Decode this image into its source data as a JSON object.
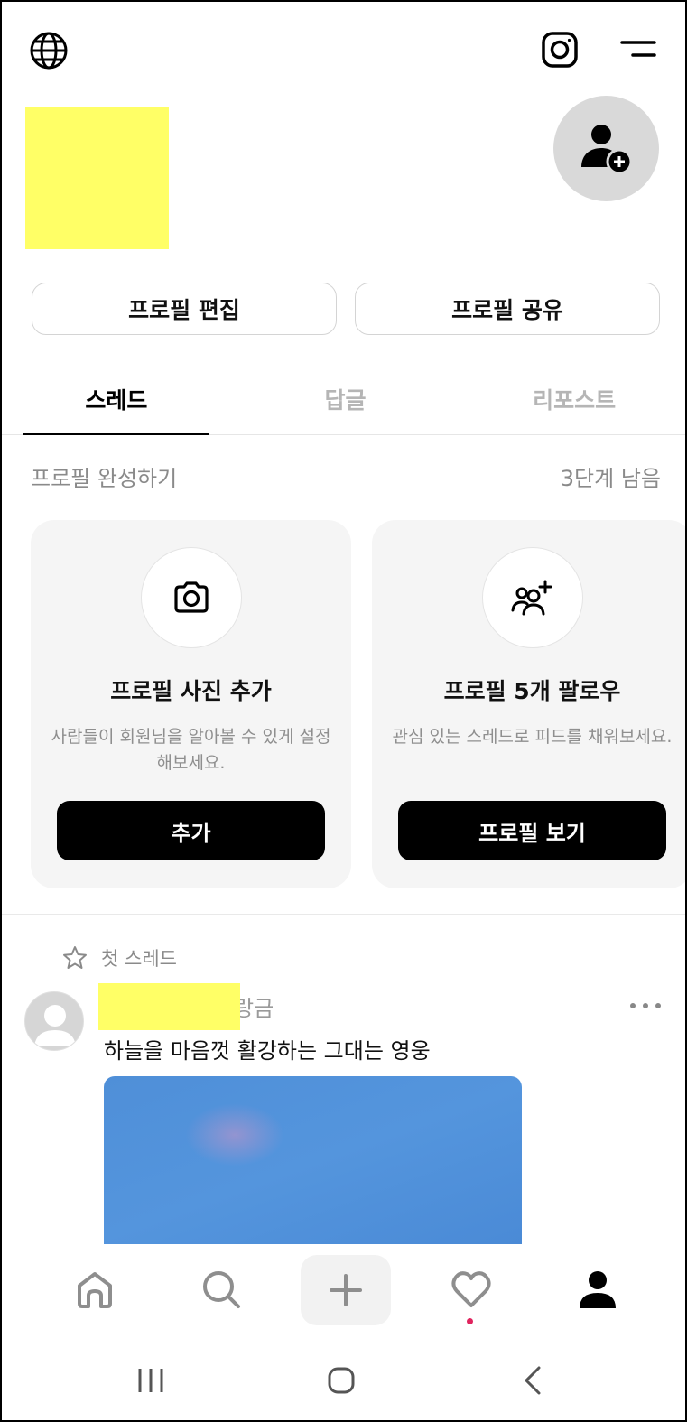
{
  "header": {
    "icons": [
      "globe-icon",
      "instagram-icon",
      "menu-icon"
    ],
    "add_profile_icon": "add-person-icon"
  },
  "profile_buttons": {
    "edit_label": "프로필 편집",
    "share_label": "프로필 공유"
  },
  "tabs": [
    {
      "label": "스레드",
      "active": true
    },
    {
      "label": "답글",
      "active": false
    },
    {
      "label": "리포스트",
      "active": false
    }
  ],
  "completion": {
    "title": "프로필 완성하기",
    "remaining": "3단계 남음",
    "cards": [
      {
        "icon": "camera-icon",
        "title": "프로필 사진 추가",
        "description": "사람들이 회원님을 알아볼 수 있게 설정해보세요.",
        "button": "추가"
      },
      {
        "icon": "add-people-icon",
        "title": "프로필 5개 팔로우",
        "description": "관심 있는 스레드로 피드를 채워보세요.",
        "button": "프로필 보기"
      }
    ]
  },
  "first_thread": {
    "label": "첫 스레드",
    "username_visible": "랑금",
    "text": "하늘을 마음껏 활강하는 그대는 영웅"
  },
  "bottom_nav": {
    "items": [
      "home-icon",
      "search-icon",
      "plus-icon",
      "heart-icon",
      "profile-icon"
    ],
    "active": "profile-icon",
    "notification_dot_color": "#e0245e"
  },
  "colors": {
    "accent": "#000000",
    "redaction": "#ffff66",
    "card_bg": "#f5f5f5"
  }
}
